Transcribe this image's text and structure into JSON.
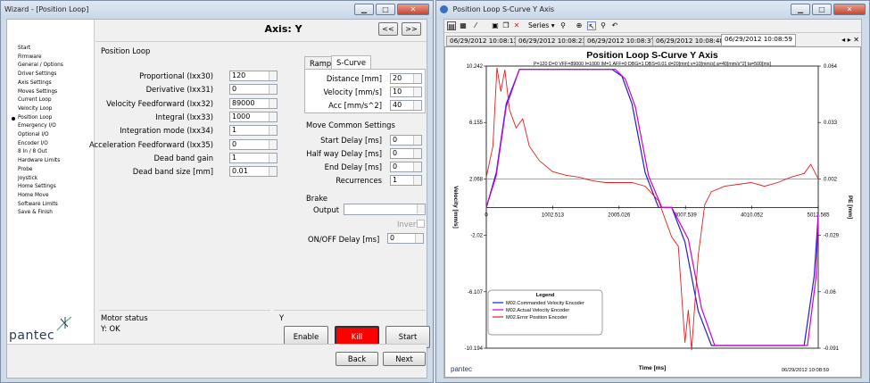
{
  "wizard": {
    "title": "Wizard - [Position Loop]",
    "nav": [
      "Start",
      "Firmware",
      "General / Options",
      "Driver Settings",
      "Axis Settings",
      "Moves Settings",
      "Current Loop",
      "Velocity Loop",
      "Position Loop",
      "Emergency I/O",
      "Optional I/O",
      "Encoder I/O",
      "8 In / 8 Out",
      "Hardware Limits",
      "Probe",
      "Joystick",
      "Home Settings",
      "Home Move",
      "Software Limits",
      "Save & Finish"
    ],
    "nav_current": 8,
    "logo": "pantec",
    "axis_title": "Axis: Y",
    "prev": "<<",
    "next_axis": ">>",
    "section": "Position Loop",
    "params": [
      {
        "label": "Proportional (Ixx30)",
        "value": "120"
      },
      {
        "label": "Derivative (Ixx31)",
        "value": "0"
      },
      {
        "label": "Velocity Feedforward (Ixx32)",
        "value": "89000"
      },
      {
        "label": "Integral (Ixx33)",
        "value": "1000"
      },
      {
        "label": "Integration mode (Ixx34)",
        "value": "1"
      },
      {
        "label": "Acceleration Feedforward (Ixx35)",
        "value": "0"
      },
      {
        "label": "Dead band gain",
        "value": "1"
      },
      {
        "label": "Dead band size [mm]",
        "value": "0.01"
      }
    ],
    "tabs": [
      "Ramp",
      "S-Curve"
    ],
    "scurve": [
      {
        "label": "Distance [mm]",
        "value": "20"
      },
      {
        "label": "Velocity [mm/s]",
        "value": "10"
      },
      {
        "label": "Acc [mm/s^2]",
        "value": "40"
      }
    ],
    "common_title": "Move Common Settings",
    "common": [
      {
        "label": "Start Delay [ms]",
        "value": "0"
      },
      {
        "label": "Half way Delay [ms]",
        "value": "0"
      },
      {
        "label": "End Delay [ms]",
        "value": "0"
      },
      {
        "label": "Recurrences",
        "value": "1"
      }
    ],
    "brake": "Brake",
    "output": "Output",
    "invert": "Invert",
    "onoff": "ON/OFF Delay [ms]",
    "onoff_value": "0",
    "motor_status": "Motor status",
    "status_text": "Y: OK",
    "y_label": "Y",
    "enable": "Enable",
    "kill": "Kill",
    "start": "Start",
    "back": "Back",
    "next": "Next"
  },
  "plotwin": {
    "title": "Position Loop S-Curve Y Axis",
    "series_btn": "Series",
    "tabs": [
      "06/29/2012 10:08:13",
      "06/29/2012 10:08:23",
      "06/29/2012 10:08:37",
      "06/29/2012 10:08:48",
      "06/29/2012 10:08:59"
    ],
    "active_tab": 4,
    "logo": "pantec",
    "stamp": "06/29/2012 10:08:59"
  },
  "colors": {
    "commanded": "#1f1fd0",
    "actual": "#d000d0",
    "error": "#e02020",
    "kill": "#ff0000"
  },
  "chart_data": {
    "type": "line",
    "title": "Position Loop S-Curve Y Axis",
    "subtitle": "P=120 D=0 VFF=89000 I=1000 IM=1 AFF=0 DBG=1 DBS=0.01 d=20[mm] v=10[mm/s] a=40[mm/s^2] ta=500[ms]",
    "xlabel": "Time [ms]",
    "ylabel": "Velocity [mm/s]",
    "y2label": "PE [mm]",
    "xlim": [
      0,
      5012.565
    ],
    "x_ticks": [
      "1002.513",
      "2005.026",
      "3007.539",
      "4010.052",
      "5012.565"
    ],
    "ylim": [
      -10.194,
      10.242
    ],
    "y_ticks": [
      "10.242",
      "6.155",
      "2.068",
      "-2.02",
      "-6.107",
      "-10.194"
    ],
    "y2lim": [
      -0.091,
      0.064
    ],
    "y2_ticks": [
      "0.064",
      "0.033",
      "0.002",
      "-0.029",
      "-0.06",
      "-0.091"
    ],
    "legend_title": "Legend",
    "legend_position": "bottom-left",
    "series": [
      {
        "name": "M02.Commanded Velocity Encoder",
        "axis": "left",
        "x": [
          0,
          150,
          300,
          500,
          1900,
          2050,
          2200,
          2400,
          2600,
          2800,
          3000,
          3200,
          3400,
          3600,
          4800,
          4950,
          5012
        ],
        "y": [
          0,
          2.5,
          7.5,
          10,
          10,
          9.5,
          7.5,
          2.5,
          0,
          0,
          -2.5,
          -7.5,
          -10,
          -10,
          -10,
          -5,
          -0.5
        ]
      },
      {
        "name": "M02.Actual Velocity Encoder",
        "axis": "left",
        "x": [
          0,
          150,
          300,
          500,
          1950,
          2100,
          2250,
          2450,
          2650,
          2800,
          3050,
          3250,
          3450,
          3650,
          4850,
          4980,
          5012
        ],
        "y": [
          0,
          2.3,
          7.3,
          10,
          10,
          9.3,
          7.3,
          2.3,
          0,
          0,
          -2.3,
          -7.3,
          -10,
          -10,
          -10,
          -5,
          -0.5
        ]
      },
      {
        "name": "M02.Error Position Encoder",
        "axis": "right",
        "x": [
          0,
          100,
          160,
          220,
          280,
          350,
          450,
          550,
          650,
          800,
          1000,
          1200,
          1400,
          1600,
          1800,
          2000,
          2200,
          2400,
          2600,
          2700,
          2800,
          2900,
          3000,
          3050,
          3100,
          3200,
          3300,
          3400,
          3600,
          3800,
          4000,
          4200,
          4400,
          4600,
          4800,
          4900,
          5012
        ],
        "y": [
          0.003,
          0.02,
          0.063,
          0.05,
          0.062,
          0.04,
          0.03,
          0.035,
          0.02,
          0.012,
          0.006,
          0.004,
          0.003,
          0.001,
          0.0,
          0.0,
          0.0,
          -0.002,
          -0.01,
          -0.02,
          -0.03,
          -0.035,
          -0.088,
          -0.07,
          -0.092,
          -0.04,
          -0.012,
          -0.005,
          -0.002,
          -0.001,
          0.0,
          -0.002,
          0.0,
          0.003,
          0.005,
          0.01,
          0.002
        ]
      }
    ]
  }
}
